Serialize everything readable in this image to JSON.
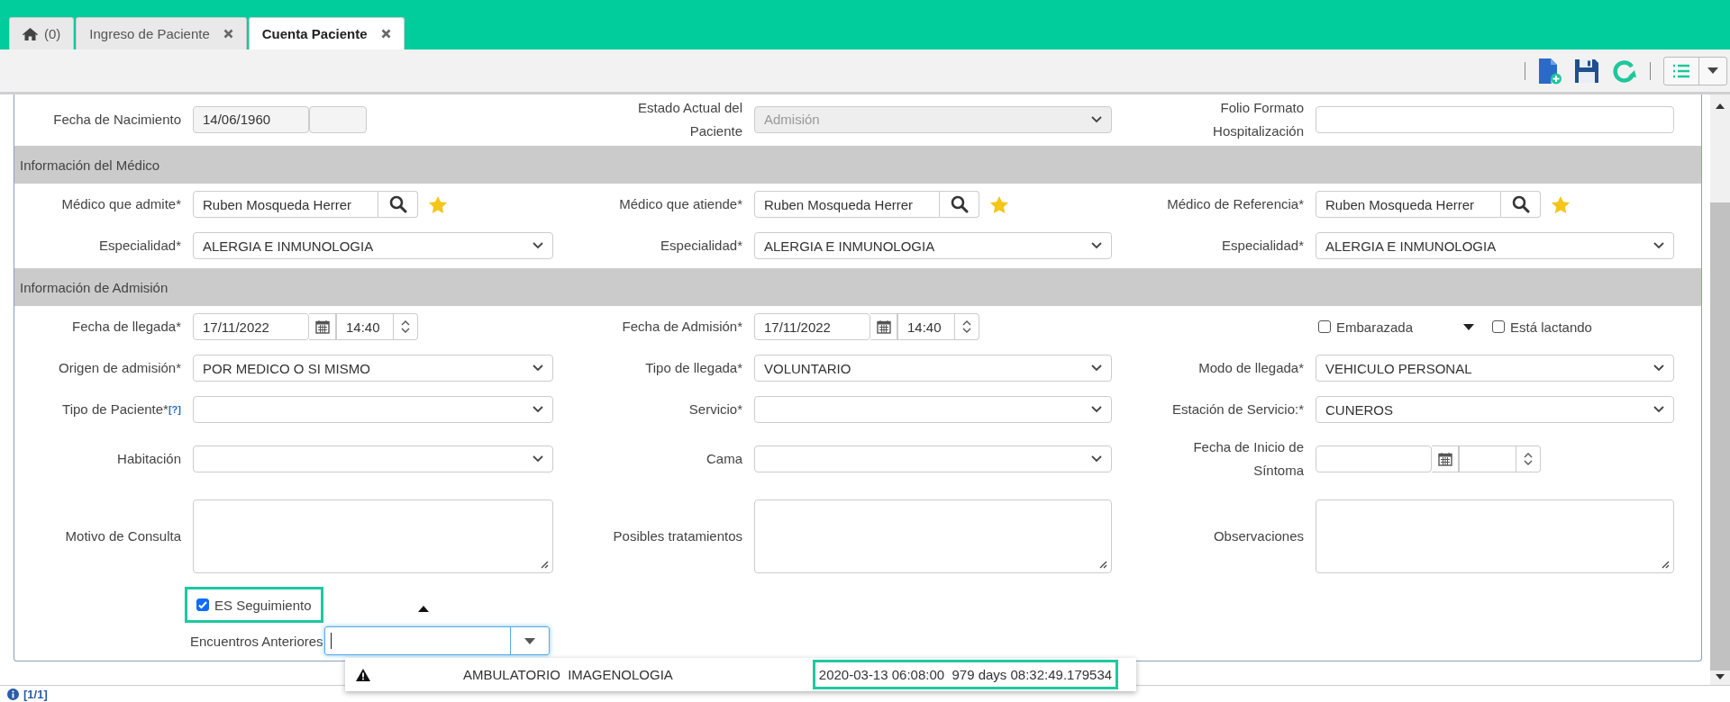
{
  "tabs": [
    {
      "kind": "home",
      "label": "(0)",
      "selected": false
    },
    {
      "kind": "page",
      "label": "Ingreso de Paciente",
      "selected": false
    },
    {
      "kind": "page",
      "label": "Cuenta Paciente",
      "selected": true
    }
  ],
  "top_fields": [
    {
      "label": "Fecha de Nacimiento",
      "kind": "date",
      "value": "14/06/1960"
    },
    {
      "label": "Estado Actual del\nPaciente",
      "kind": "select",
      "value": "Admisión",
      "disabled": true
    },
    {
      "label": "Folio Formato\nHospitalización",
      "kind": "text"
    }
  ],
  "sections": [
    {
      "title": "Información del Médico",
      "rows": [
        [
          {
            "label": "Médico que admite*",
            "kind": "lookup",
            "value": "Ruben Mosqueda Herrer"
          },
          {
            "label": "Médico que atiende*",
            "kind": "lookup",
            "value": "Ruben Mosqueda Herrer"
          },
          {
            "label": "Médico de Referencia*",
            "kind": "lookup",
            "value": "Ruben Mosqueda Herrer"
          }
        ],
        [
          {
            "label": "Especialidad*",
            "kind": "select",
            "value": "ALERGIA E INMUNOLOGIA"
          },
          {
            "label": "Especialidad*",
            "kind": "select",
            "value": "ALERGIA E INMUNOLOGIA"
          },
          {
            "label": "Especialidad*",
            "kind": "select",
            "value": "ALERGIA E INMUNOLOGIA"
          }
        ]
      ]
    },
    {
      "title": "Información de Admisión",
      "rows": [
        [
          {
            "label": "Fecha de llegada*",
            "kind": "datetime",
            "date": "17/11/2022",
            "time": "14:40"
          },
          {
            "label": "Fecha de Admisión*",
            "kind": "datetime",
            "date": "17/11/2022",
            "time": "14:40"
          },
          {
            "kind": "checks",
            "items": [
              {
                "label": "Embarazada",
                "checked": false
              },
              {
                "label": "Está lactando",
                "checked": false
              }
            ]
          }
        ],
        [
          {
            "label": "Origen de admisión*",
            "kind": "select",
            "value": "POR MEDICO O SI MISMO"
          },
          {
            "label": "Tipo de llegada*",
            "kind": "select",
            "value": "VOLUNTARIO"
          },
          {
            "label": "Modo de llegada*",
            "kind": "select",
            "value": "VEHICULO PERSONAL"
          }
        ],
        [
          {
            "label": "Tipo de Paciente*",
            "help": "[?]",
            "kind": "select"
          },
          {
            "label": "Servicio*",
            "kind": "select"
          },
          {
            "label": "Estación de Servicio:*",
            "kind": "select",
            "value": "CUNEROS"
          }
        ],
        [
          {
            "label": "Habitación",
            "kind": "select"
          },
          {
            "label": "Cama",
            "kind": "select"
          },
          {
            "label": "Fecha de Inicio de\nSíntoma",
            "kind": "datetime"
          }
        ],
        [
          {
            "label": "Motivo de Consulta",
            "kind": "textarea"
          },
          {
            "label": "Posibles tratamientos",
            "kind": "textarea"
          },
          {
            "label": "Observaciones",
            "kind": "textarea"
          }
        ]
      ]
    }
  ],
  "follow_up": {
    "label": "ES Seguimiento",
    "checked": true,
    "highlighted": true
  },
  "previous_encounters": {
    "label": "Encuentros Anteriores"
  },
  "dropdown_options": [
    {
      "service": "AMBULATORIO  IMAGENOLOGIA",
      "date": "2020-03-13 06:08:00  979 days 08:32:49.179534",
      "highlighted": true
    }
  ],
  "pagination": "[1/1]"
}
